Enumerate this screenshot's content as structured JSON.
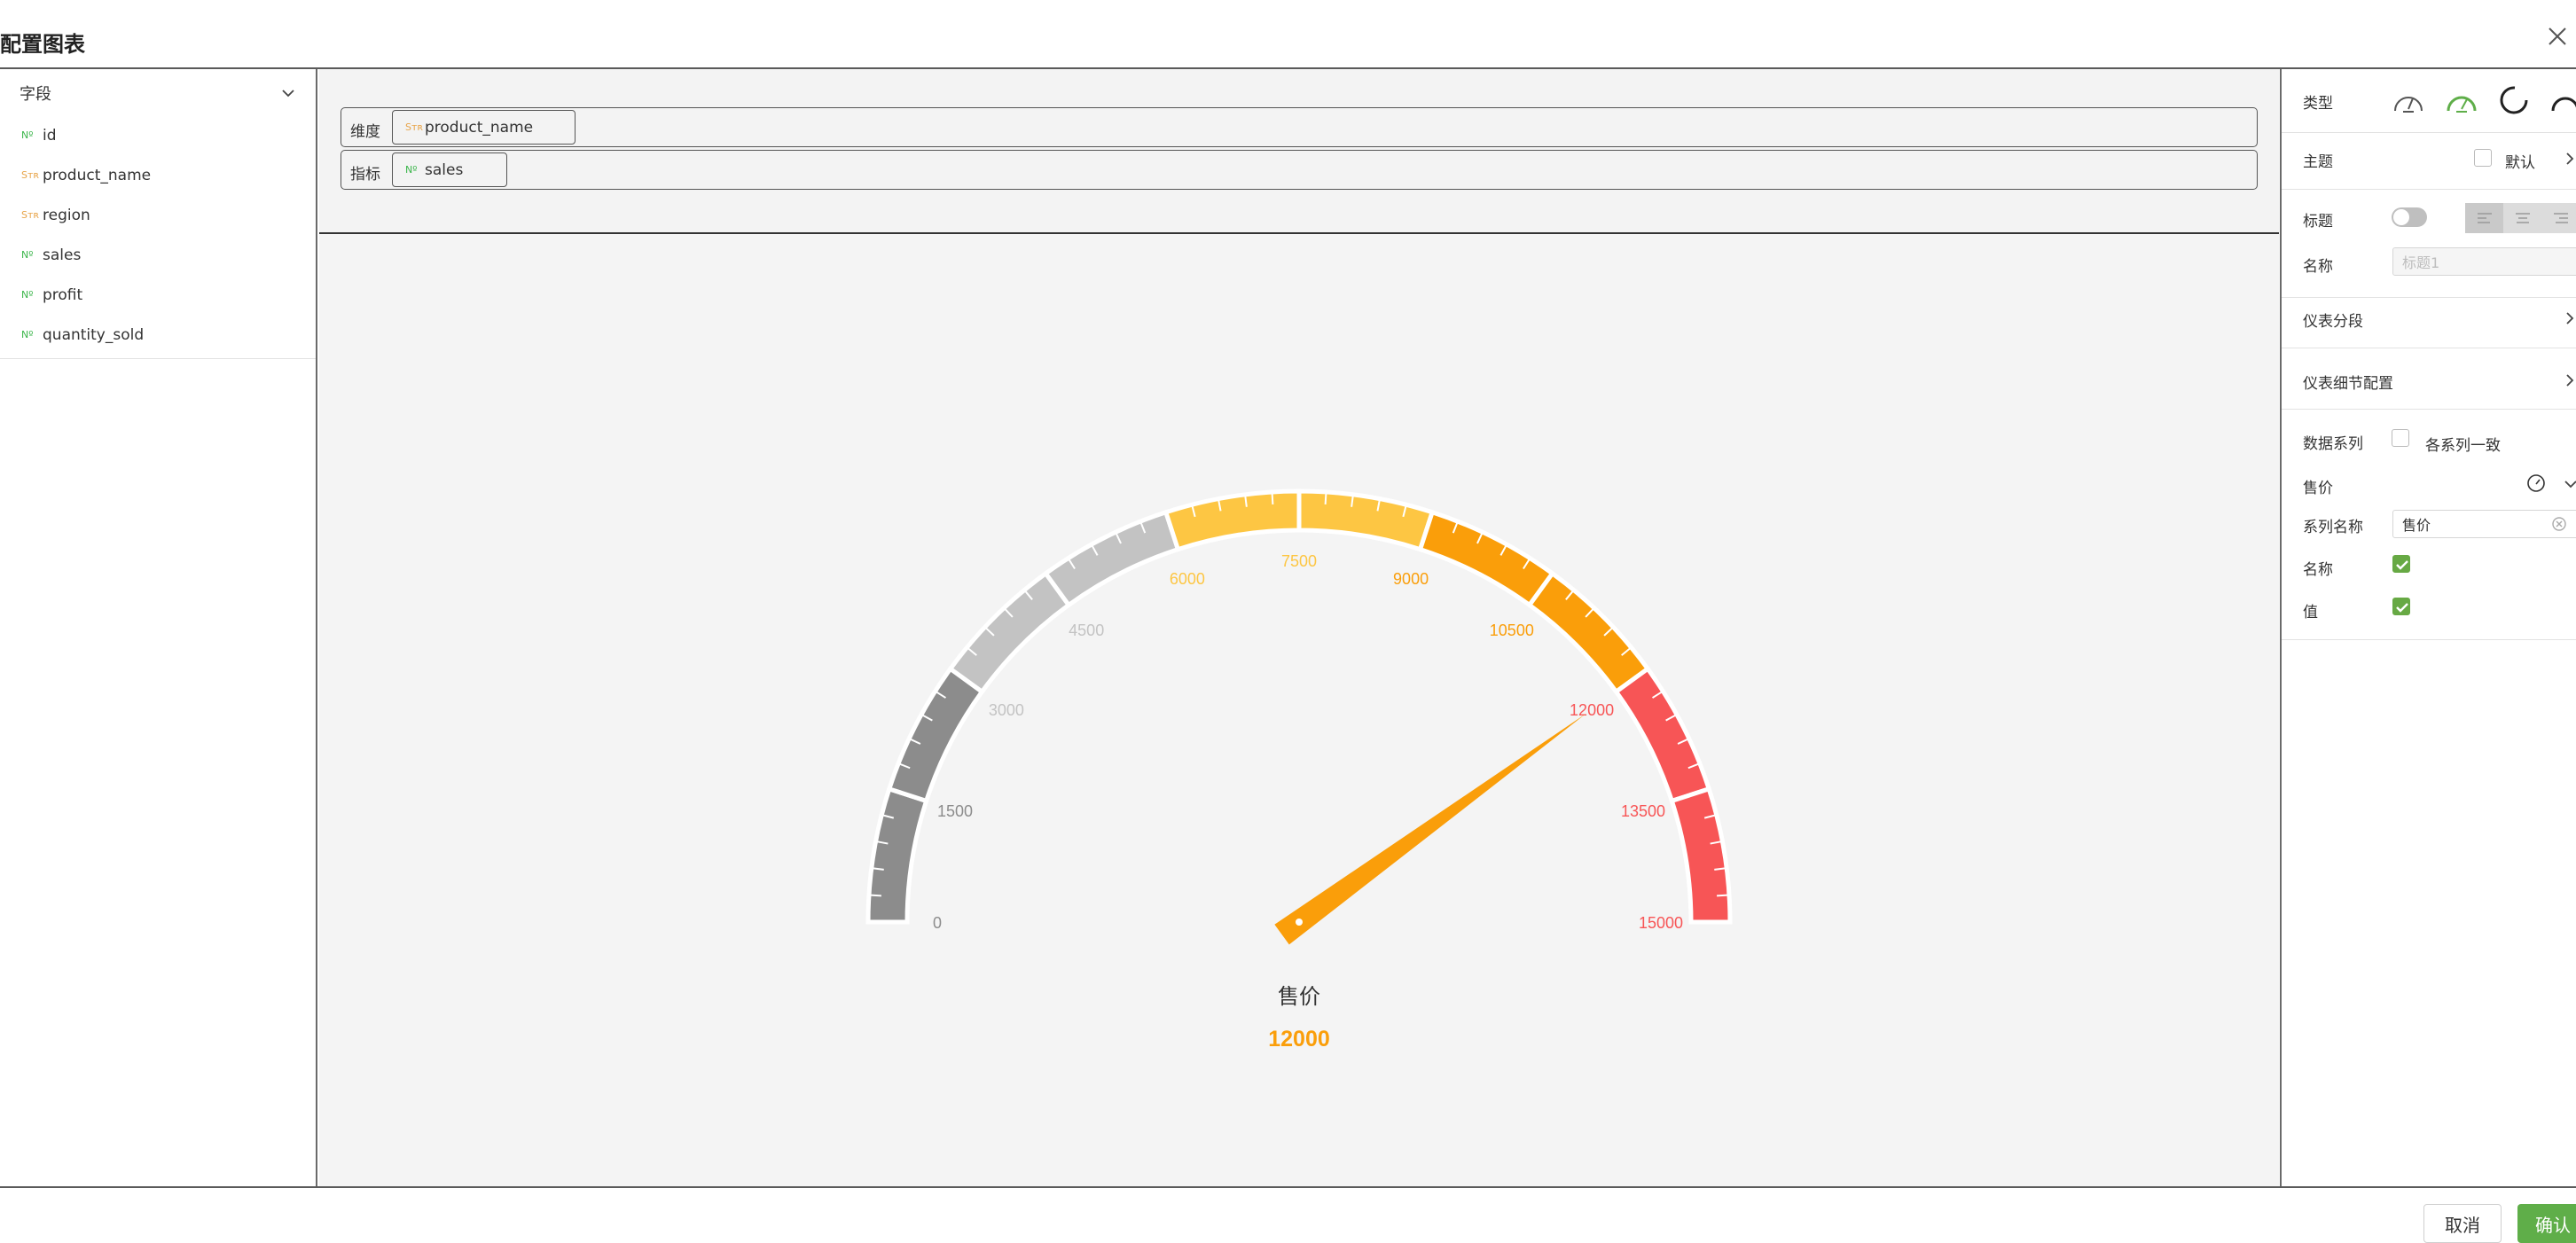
{
  "dialog": {
    "title": "配置图表"
  },
  "fields_panel": {
    "header": "字段",
    "fields": [
      {
        "type": "Nº",
        "kind": "num",
        "name": "id"
      },
      {
        "type": "Sᴛʀ",
        "kind": "str",
        "name": "product_name"
      },
      {
        "type": "Sᴛʀ",
        "kind": "str",
        "name": "region"
      },
      {
        "type": "Nº",
        "kind": "num",
        "name": "sales"
      },
      {
        "type": "Nº",
        "kind": "num",
        "name": "profit"
      },
      {
        "type": "Nº",
        "kind": "num",
        "name": "quantity_sold"
      }
    ]
  },
  "dropzone": {
    "dimension": {
      "label": "维度",
      "type": "Sᴛʀ",
      "field": "product_name"
    },
    "metric": {
      "label": "指标",
      "type": "Nº",
      "field": "sales"
    }
  },
  "chart_data": {
    "type": "gauge",
    "min": 0,
    "max": 15000,
    "value": 12000,
    "series_name": "售价",
    "value_label": "12000",
    "tick_labels": [
      "0",
      "1500",
      "3000",
      "4500",
      "6000",
      "7500",
      "9000",
      "10500",
      "12000",
      "13500",
      "15000"
    ],
    "segments": [
      {
        "from": 0,
        "to": 3000,
        "color": "#8c8c8c"
      },
      {
        "from": 3000,
        "to": 6000,
        "color": "#c3c3c3"
      },
      {
        "from": 6000,
        "to": 9000,
        "color": "#fdc643"
      },
      {
        "from": 9000,
        "to": 12000,
        "color": "#fa9e0a"
      },
      {
        "from": 12000,
        "to": 15000,
        "color": "#f75556"
      }
    ],
    "pointer_color": "#fa9e0a"
  },
  "settings_panel": {
    "type_label": "类型",
    "theme_label": "主题",
    "theme_default": "默认",
    "title_label": "标题",
    "name_label": "名称",
    "name_placeholder": "标题1",
    "gauge_segments": "仪表分段",
    "gauge_detail": "仪表细节配置",
    "data_series_label": "数据系列",
    "same_series": "各系列一致",
    "series_item": "售价",
    "series_name_label": "系列名称",
    "series_name_value": "售价",
    "show_name_label": "名称",
    "show_value_label": "值"
  },
  "footer": {
    "cancel": "取消",
    "confirm": "确认"
  },
  "colors": {
    "accent": "#5fae49",
    "num_tag": "#3ab54a",
    "str_tag": "#e8a54a"
  }
}
